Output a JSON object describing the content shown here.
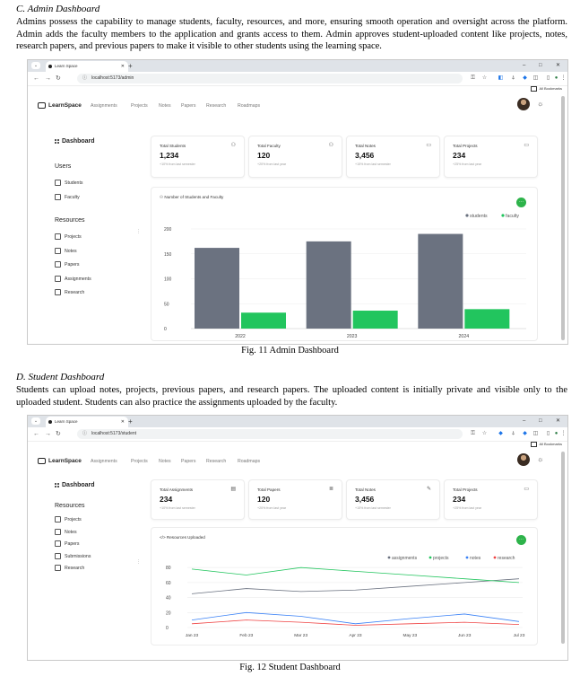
{
  "section_c": {
    "title": "C.   Admin Dashboard",
    "paragraph": "Admins possess the capability to manage students, faculty, resources, and more, ensuring smooth operation and oversight across the platform. Admin adds the faculty members to the application and grants access to them. Admin approves student-uploaded content like projects, notes, research papers, and previous papers to make it visible to other students using the learning space.",
    "caption": "Fig. 11 Admin Dashboard"
  },
  "section_d": {
    "title": "D.   Student Dashboard",
    "paragraph": "Students can upload notes, projects, previous papers, and research papers. The uploaded content is initially private and visible only to the uploaded student. Students can also practice the assignments uploaded by the faculty.",
    "caption": "Fig. 12 Student Dashboard"
  },
  "browser": {
    "tab_title": "Learn Space",
    "all_bookmarks": "All Bookmarks",
    "window_controls": [
      "–",
      "□",
      "✕"
    ]
  },
  "app": {
    "logo": "LearnSpace",
    "nav": [
      "Assignments",
      "Projects",
      "Notes",
      "Papers",
      "Research",
      "Roadmaps"
    ]
  },
  "admin": {
    "url": "localhost:5173/admin",
    "sidebar": {
      "dashboard": "Dashboard",
      "users_heading": "Users",
      "users": [
        "Students",
        "Faculty"
      ],
      "resources_heading": "Resources",
      "resources": [
        "Projects",
        "Notes",
        "Papers",
        "Assignments",
        "Research"
      ]
    },
    "cards": [
      {
        "title": "Total Students",
        "value": "1,234",
        "note": "+10% from last semester",
        "icon": "users-icon"
      },
      {
        "title": "Total Faculty",
        "value": "120",
        "note": "+20% from last year",
        "icon": "users-icon"
      },
      {
        "title": "Total Notes",
        "value": "3,456",
        "note": "+15% from last semester",
        "icon": "file-icon"
      },
      {
        "title": "Total Projects",
        "value": "234",
        "note": "+25% from last year",
        "icon": "file-icon"
      }
    ],
    "chart_title": "Number of Students and Faculty"
  },
  "student": {
    "url": "localhost:5173/student",
    "sidebar": {
      "dashboard": "Dashboard",
      "resources_heading": "Resources",
      "resources": [
        "Projects",
        "Notes",
        "Papers",
        "Submissions",
        "Research"
      ]
    },
    "cards": [
      {
        "title": "Total Assignments",
        "value": "234",
        "note": "+10% from last semester",
        "icon": "clipboard-icon"
      },
      {
        "title": "Total Papers",
        "value": "120",
        "note": "+20% from last year",
        "icon": "layers-icon"
      },
      {
        "title": "Total Notes",
        "value": "3,456",
        "note": "+15% from last semester",
        "icon": "pencil-icon"
      },
      {
        "title": "Total Projects",
        "value": "234",
        "note": "+25% from last year",
        "icon": "monitor-icon"
      }
    ],
    "chart_title": "Resources Uploaded"
  },
  "colors": {
    "students": "#6b7280",
    "faculty": "#22c55e",
    "assignments": "#6b7280",
    "projects": "#22c55e",
    "notes": "#3b82f6",
    "research": "#ef4444",
    "accent": "#2db34a"
  },
  "chart_data": [
    {
      "type": "bar",
      "title": "Number of Students and Faculty",
      "categories": [
        "2022",
        "2023",
        "2024"
      ],
      "series": [
        {
          "name": "students",
          "values": [
            162,
            175,
            190
          ]
        },
        {
          "name": "faculty",
          "values": [
            32,
            36,
            39
          ]
        }
      ],
      "yticks": [
        "0",
        "50",
        "100",
        "150",
        "200"
      ],
      "ylim": [
        0,
        200
      ],
      "legend": "top-right",
      "grid": true
    },
    {
      "type": "line",
      "title": "Resources Uploaded",
      "x": [
        "Jan 23",
        "Feb 23",
        "Mar 23",
        "Apr 23",
        "May 23",
        "Jun 23",
        "Jul 23"
      ],
      "series": [
        {
          "name": "assignments",
          "values": [
            45,
            52,
            48,
            50,
            55,
            60,
            65
          ]
        },
        {
          "name": "projects",
          "values": [
            78,
            70,
            80,
            75,
            70,
            65,
            60
          ]
        },
        {
          "name": "notes",
          "values": [
            10,
            20,
            15,
            5,
            12,
            18,
            8
          ]
        },
        {
          "name": "research",
          "values": [
            5,
            10,
            7,
            3,
            5,
            7,
            4
          ]
        }
      ],
      "yticks": [
        "0",
        "20",
        "40",
        "60",
        "80"
      ],
      "ylim": [
        0,
        85
      ],
      "legend": "top-right",
      "grid": true
    }
  ]
}
